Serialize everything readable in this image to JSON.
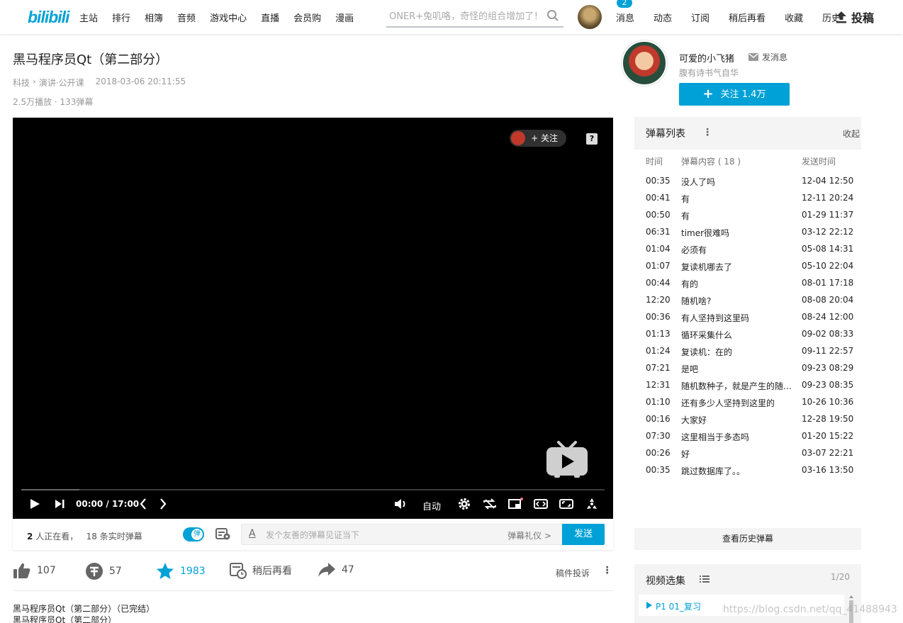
{
  "header": {
    "logo": "bilibili",
    "nav_left": [
      "主站",
      "排行",
      "相簿",
      "音频",
      "游戏中心",
      "直播",
      "会员购",
      "漫画"
    ],
    "search_placeholder": "ONER+兔叽咯，奇怪的组合增加了！",
    "nav_right": [
      "消息",
      "动态",
      "订阅",
      "稍后再看",
      "收藏",
      "历史"
    ],
    "message_badge": "2",
    "upload_label": "投稿"
  },
  "video": {
    "title": "黑马程序员Qt（第二部分）",
    "category": "科技",
    "subcategory": "演讲·公开课",
    "publish_time": "2018-03-06 20:11:55",
    "stats": "2.5万播放 · 133弹幕"
  },
  "player": {
    "follow_label": "关注",
    "current_time": "00:00",
    "total_time": "17:00",
    "quality_label": "自动",
    "progress_fraction": 0,
    "buffered_fraction": 0.1
  },
  "sendbar": {
    "watching_count": "2",
    "watching_text": "人正在看，",
    "danmaku_count_text": "18 条实时弹幕",
    "toggle_label": "弹",
    "input_placeholder": "发个友善的弹幕见证当下",
    "etiquette_label": "弹幕礼仪 >",
    "send_label": "发送"
  },
  "actions": {
    "like_count": "107",
    "coin_count": "57",
    "fav_count": "1983",
    "watch_later_label": "稍后再看",
    "share_count": "47",
    "report_label": "稿件投诉"
  },
  "description": {
    "line1": "黑马程序员Qt（第二部分）（已完结）",
    "line2": "黑马程序员Qt（第二部分）"
  },
  "uploader": {
    "name": "可爱的小飞猪",
    "message_label": "发消息",
    "signature": "腹有诗书气自华",
    "follow_label": "关注 1.4万"
  },
  "danmaku_list": {
    "title": "弹幕列表",
    "fold_label": "收起",
    "col_time": "时间",
    "col_content": "弹幕内容 ( 18 )",
    "col_sent": "发送时间",
    "rows": [
      {
        "time": "00:35",
        "content": "没人了吗",
        "sent": "12-04 12:50"
      },
      {
        "time": "00:41",
        "content": "有",
        "sent": "12-11 20:24"
      },
      {
        "time": "00:50",
        "content": "有",
        "sent": "01-29 11:37"
      },
      {
        "time": "06:31",
        "content": "timer很难吗",
        "sent": "03-12 22:12"
      },
      {
        "time": "01:04",
        "content": "必须有",
        "sent": "05-08 14:31"
      },
      {
        "time": "01:07",
        "content": "复读机哪去了",
        "sent": "05-10 22:04"
      },
      {
        "time": "00:44",
        "content": "有的",
        "sent": "08-01 17:18"
      },
      {
        "time": "12:20",
        "content": "随机啥?",
        "sent": "08-08 20:04"
      },
      {
        "time": "00:36",
        "content": "有人坚持到这里码",
        "sent": "08-24 12:00"
      },
      {
        "time": "01:13",
        "content": "循环采集什么",
        "sent": "09-02 08:33"
      },
      {
        "time": "01:24",
        "content": "复读机：在的",
        "sent": "09-11 22:57"
      },
      {
        "time": "07:21",
        "content": "是吧",
        "sent": "09-23 08:29"
      },
      {
        "time": "12:31",
        "content": "随机数种子，就是产生的随机数",
        "sent": "09-23 08:35"
      },
      {
        "time": "01:10",
        "content": "还有多少人坚持到这里的",
        "sent": "10-26 10:36"
      },
      {
        "time": "00:16",
        "content": "大家好",
        "sent": "12-28 19:50"
      },
      {
        "time": "07:30",
        "content": "这里相当于多态吗",
        "sent": "01-20 15:22"
      },
      {
        "time": "00:26",
        "content": "好",
        "sent": "03-07 22:21"
      },
      {
        "time": "00:35",
        "content": "跳过数据库了。。",
        "sent": "03-16 13:50"
      }
    ],
    "history_label": "查看历史弹幕"
  },
  "episodes": {
    "title": "视频选集",
    "page": "1/20",
    "current": "P1  01_复习"
  },
  "watermark": "https://blog.csdn.net/qq_41488943",
  "colors": {
    "accent": "#00a1d6"
  }
}
